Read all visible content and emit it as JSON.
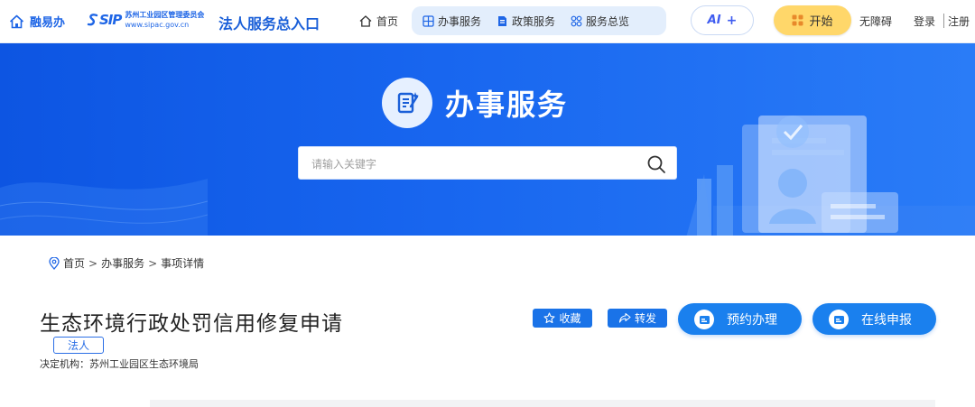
{
  "topbar": {
    "home_brand": "融易办",
    "sip_mark": "SIP",
    "sip_name": "苏州工业园区管理委员会",
    "sip_url": "www.sipac.gov.cn",
    "portal_title": "法人服务总入口",
    "nav": {
      "home": "首页",
      "items": [
        {
          "label": "办事服务",
          "icon": "grid-icon"
        },
        {
          "label": "政策服务",
          "icon": "policy-doc-icon"
        },
        {
          "label": "服务总览",
          "icon": "overview-icon"
        }
      ]
    },
    "ai_label": "AI",
    "ai_plus": "+",
    "start_label": "开始",
    "accessibility": "无障碍",
    "login": "登录",
    "register": "注册"
  },
  "banner": {
    "title": "办事服务",
    "search_placeholder": "请输入关键字"
  },
  "breadcrumb": {
    "home": "首页",
    "sep1": ">",
    "section": "办事服务",
    "sep2": ">",
    "current": "事项详情"
  },
  "item": {
    "title": "生态环境行政处罚信用修复申请",
    "tag": "法人",
    "decision_org": "决定机构：苏州工业园区生态环境局",
    "favorite_label": "收藏",
    "forward_label": "转发",
    "appointment_label": "预约办理",
    "online_apply_label": "在线申报"
  },
  "colors": {
    "brand_blue": "#1f66e6",
    "banner_blue": "#1866ef",
    "button_blue": "#1a80ee",
    "start_yellow": "#ffd76a",
    "nav_pill_bg": "#e3eefc"
  }
}
